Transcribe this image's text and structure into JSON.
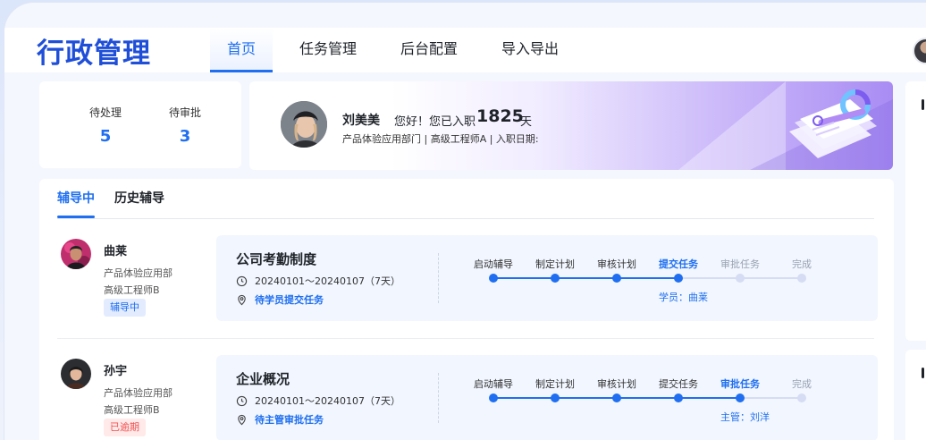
{
  "app": {
    "title": "行政管理"
  },
  "nav": {
    "items": [
      {
        "label": "首页",
        "active": true
      },
      {
        "label": "任务管理",
        "active": false
      },
      {
        "label": "后台配置",
        "active": false
      },
      {
        "label": "导入导出",
        "active": false
      }
    ]
  },
  "stats": {
    "pending": {
      "label": "待处理",
      "value": "5"
    },
    "approval": {
      "label": "待审批",
      "value": "3"
    }
  },
  "profile": {
    "name": "刘美美",
    "greeting": "您好！您已入职",
    "days": "1825",
    "unit": "天",
    "meta": "产品体验应用部门 | 高级工程师A | 入职日期:"
  },
  "tabs": [
    {
      "label": "辅导中",
      "active": true
    },
    {
      "label": "历史辅导",
      "active": false
    }
  ],
  "rows": [
    {
      "name": "曲莱",
      "dept": "产品体验应用部",
      "title": "高级工程师B",
      "badge": "辅导中",
      "badge_color": "#1f6ff0",
      "task_title": "公司考勤制度",
      "task_date": "20240101～20240107（7天）",
      "task_status": "待学员提交任务",
      "steps": [
        "启动辅导",
        "制定计划",
        "审核计划",
        "提交任务",
        "审批任务",
        "完成"
      ],
      "current_step": 3,
      "note": "学员：曲莱"
    },
    {
      "name": "孙宇",
      "dept": "产品体验应用部",
      "title": "高级工程师B",
      "badge": "已逾期",
      "badge_color": "#f05252",
      "task_title": "企业概况",
      "task_date": "20240101～20240107（7天）",
      "task_status": "待主管审批任务",
      "steps": [
        "启动辅导",
        "制定计划",
        "审核计划",
        "提交任务",
        "审批任务",
        "完成"
      ],
      "current_step": 4,
      "note": "主管：刘洋"
    }
  ],
  "colors": {
    "accent": "#1f6ff0",
    "logo": "#1f4fd8",
    "pending": "#d6dcf3"
  }
}
